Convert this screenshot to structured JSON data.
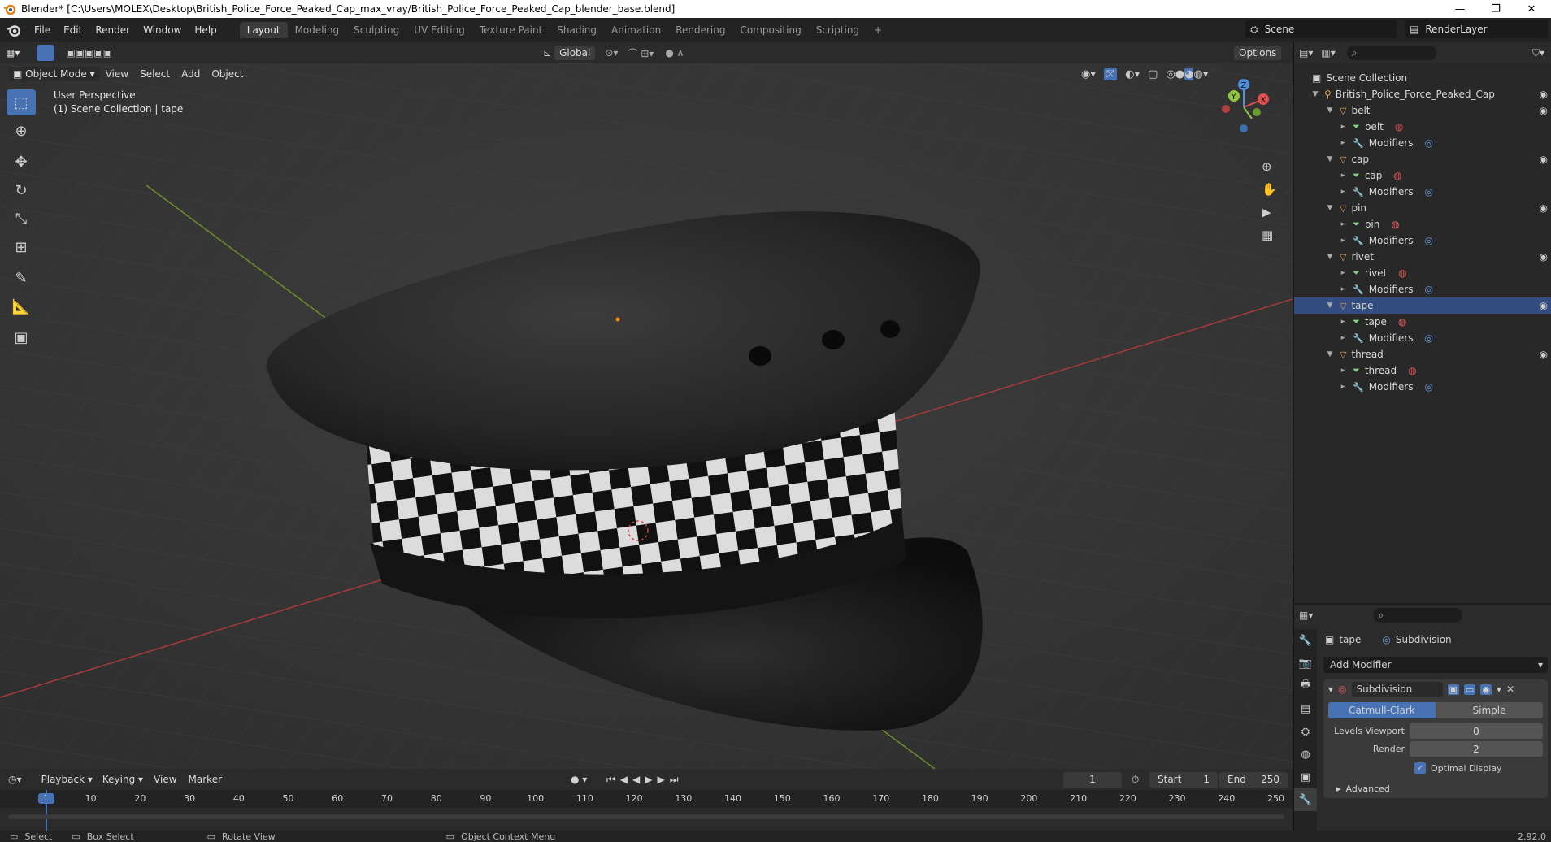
{
  "window": {
    "title": "Blender* [C:\\Users\\MOLEX\\Desktop\\British_Police_Force_Peaked_Cap_max_vray/British_Police_Force_Peaked_Cap_blender_base.blend]",
    "minimize": "—",
    "maximize": "❐",
    "close": "✕"
  },
  "menu": [
    "File",
    "Edit",
    "Render",
    "Window",
    "Help"
  ],
  "workspaces": [
    "Layout",
    "Modeling",
    "Sculpting",
    "UV Editing",
    "Texture Paint",
    "Shading",
    "Animation",
    "Rendering",
    "Compositing",
    "Scripting"
  ],
  "workspace_add": "+",
  "scene": {
    "name": "Scene",
    "render_layer": "RenderLayer"
  },
  "toolbar": {
    "transform_orientation": "Global",
    "options": "Options"
  },
  "viewport_header": {
    "mode": "Object Mode",
    "view": "View",
    "select": "Select",
    "add": "Add",
    "object": "Object"
  },
  "viewport": {
    "perspective": "User Perspective",
    "collection_info": "(1) Scene Collection | tape"
  },
  "gizmo": {
    "x": "X",
    "y": "Y",
    "z": "Z"
  },
  "outliner": {
    "root": "Scene Collection",
    "collection": "British_Police_Force_Peaked_Cap",
    "objects": [
      {
        "name": "belt",
        "mesh": "belt",
        "modifiers": "Modifiers"
      },
      {
        "name": "cap",
        "mesh": "cap",
        "modifiers": "Modifiers"
      },
      {
        "name": "pin",
        "mesh": "pin",
        "modifiers": "Modifiers"
      },
      {
        "name": "rivet",
        "mesh": "rivet",
        "modifiers": "Modifiers"
      },
      {
        "name": "tape",
        "mesh": "tape",
        "modifiers": "Modifiers"
      },
      {
        "name": "thread",
        "mesh": "thread",
        "modifiers": "Modifiers"
      }
    ]
  },
  "properties": {
    "object": "tape",
    "modifier_crumb": "Subdivision",
    "add_modifier": "Add Modifier",
    "modifier_name": "Subdivision",
    "catmull": "Catmull-Clark",
    "simple": "Simple",
    "levels_viewport_label": "Levels Viewport",
    "levels_viewport": "0",
    "render_label": "Render",
    "render": "2",
    "optimal_display": "Optimal Display",
    "optimal_checked": true,
    "advanced": "Advanced"
  },
  "timeline": {
    "playback": "Playback",
    "keying": "Keying",
    "view": "View",
    "marker": "Marker",
    "current_frame": "1",
    "start_label": "Start",
    "start": "1",
    "end_label": "End",
    "end": "250",
    "ticks": [
      "1",
      "10",
      "20",
      "30",
      "40",
      "50",
      "60",
      "70",
      "80",
      "90",
      "100",
      "110",
      "120",
      "130",
      "140",
      "150",
      "160",
      "170",
      "180",
      "190",
      "200",
      "210",
      "220",
      "230",
      "240",
      "250"
    ]
  },
  "status": {
    "select": "Select",
    "box_select": "Box Select",
    "rotate_view": "Rotate View",
    "context_menu": "Object Context Menu",
    "version": "2.92.0"
  },
  "colors": {
    "accent": "#4772b3",
    "header": "#232323",
    "panel": "#282828",
    "collection_icon": "#e0a050",
    "mesh_icon": "#7fd67f",
    "material_icon": "#e05a5a",
    "modifier_icon": "#6a9fdd"
  }
}
